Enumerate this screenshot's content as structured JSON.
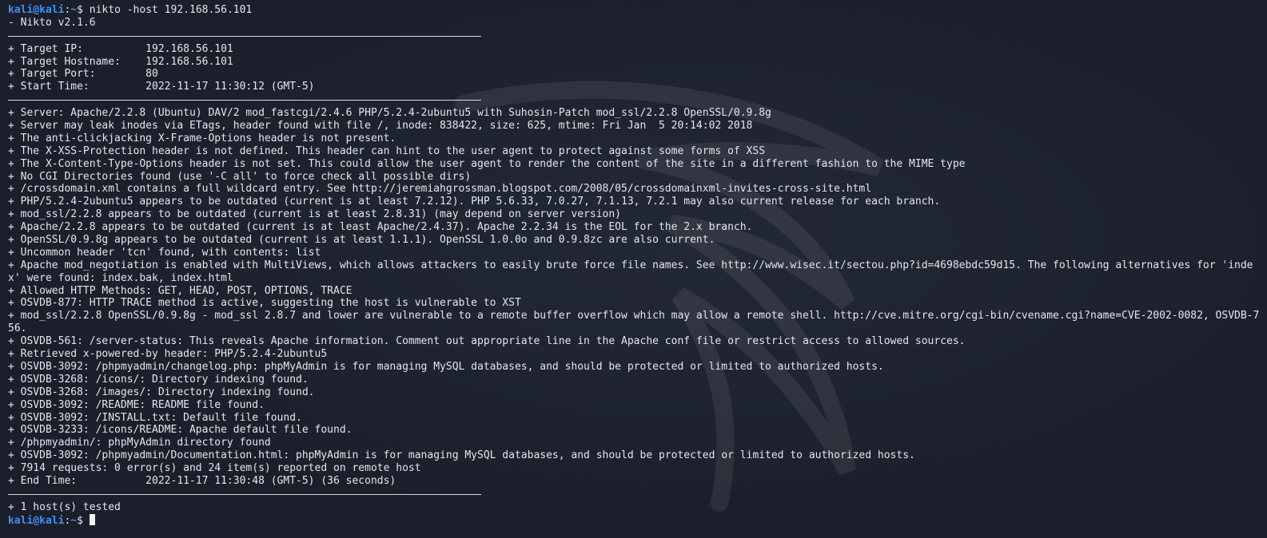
{
  "prompt_first": {
    "user_host": "kali@kali",
    "sep": ":",
    "path": "~",
    "symbol": "$",
    "command": " nikto -host 192.168.56.101"
  },
  "version_line": "- Nikto v2.1.6",
  "target": [
    "+ Target IP:          192.168.56.101",
    "+ Target Hostname:    192.168.56.101",
    "+ Target Port:        80",
    "+ Start Time:         2022-11-17 11:30:12 (GMT-5)"
  ],
  "findings": [
    "+ Server: Apache/2.2.8 (Ubuntu) DAV/2 mod_fastcgi/2.4.6 PHP/5.2.4-2ubuntu5 with Suhosin-Patch mod_ssl/2.2.8 OpenSSL/0.9.8g",
    "+ Server may leak inodes via ETags, header found with file /, inode: 838422, size: 625, mtime: Fri Jan  5 20:14:02 2018",
    "+ The anti-clickjacking X-Frame-Options header is not present.",
    "+ The X-XSS-Protection header is not defined. This header can hint to the user agent to protect against some forms of XSS",
    "+ The X-Content-Type-Options header is not set. This could allow the user agent to render the content of the site in a different fashion to the MIME type",
    "+ No CGI Directories found (use '-C all' to force check all possible dirs)",
    "+ /crossdomain.xml contains a full wildcard entry. See http://jeremiahgrossman.blogspot.com/2008/05/crossdomainxml-invites-cross-site.html",
    "+ PHP/5.2.4-2ubuntu5 appears to be outdated (current is at least 7.2.12). PHP 5.6.33, 7.0.27, 7.1.13, 7.2.1 may also current release for each branch.",
    "+ mod_ssl/2.2.8 appears to be outdated (current is at least 2.8.31) (may depend on server version)",
    "+ Apache/2.2.8 appears to be outdated (current is at least Apache/2.4.37). Apache 2.2.34 is the EOL for the 2.x branch.",
    "+ OpenSSL/0.9.8g appears to be outdated (current is at least 1.1.1). OpenSSL 1.0.0o and 0.9.8zc are also current.",
    "+ Uncommon header 'tcn' found, with contents: list",
    "+ Apache mod_negotiation is enabled with MultiViews, which allows attackers to easily brute force file names. See http://www.wisec.it/sectou.php?id=4698ebdc59d15. The following alternatives for 'index' were found: index.bak, index.html",
    "+ Allowed HTTP Methods: GET, HEAD, POST, OPTIONS, TRACE",
    "+ OSVDB-877: HTTP TRACE method is active, suggesting the host is vulnerable to XST",
    "+ mod_ssl/2.2.8 OpenSSL/0.9.8g - mod_ssl 2.8.7 and lower are vulnerable to a remote buffer overflow which may allow a remote shell. http://cve.mitre.org/cgi-bin/cvename.cgi?name=CVE-2002-0082, OSVDB-756.",
    "+ OSVDB-561: /server-status: This reveals Apache information. Comment out appropriate line in the Apache conf file or restrict access to allowed sources.",
    "+ Retrieved x-powered-by header: PHP/5.2.4-2ubuntu5",
    "+ OSVDB-3092: /phpmyadmin/changelog.php: phpMyAdmin is for managing MySQL databases, and should be protected or limited to authorized hosts.",
    "+ OSVDB-3268: /icons/: Directory indexing found.",
    "+ OSVDB-3268: /images/: Directory indexing found.",
    "+ OSVDB-3092: /README: README file found.",
    "+ OSVDB-3092: /INSTALL.txt: Default file found.",
    "+ OSVDB-3233: /icons/README: Apache default file found.",
    "+ /phpmyadmin/: phpMyAdmin directory found",
    "+ OSVDB-3092: /phpmyadmin/Documentation.html: phpMyAdmin is for managing MySQL databases, and should be protected or limited to authorized hosts.",
    "+ 7914 requests: 0 error(s) and 24 item(s) reported on remote host",
    "+ End Time:           2022-11-17 11:30:48 (GMT-5) (36 seconds)"
  ],
  "summary_line": "+ 1 host(s) tested",
  "prompt_last": {
    "user_host": "kali@kali",
    "sep": ":",
    "path": "~",
    "symbol": "$ "
  },
  "colors": {
    "background": "#1b1f2b",
    "prompt": "#3f8ef7",
    "text": "#e4e6ea"
  },
  "icons": {
    "watermark": "kali-dragon-icon"
  }
}
